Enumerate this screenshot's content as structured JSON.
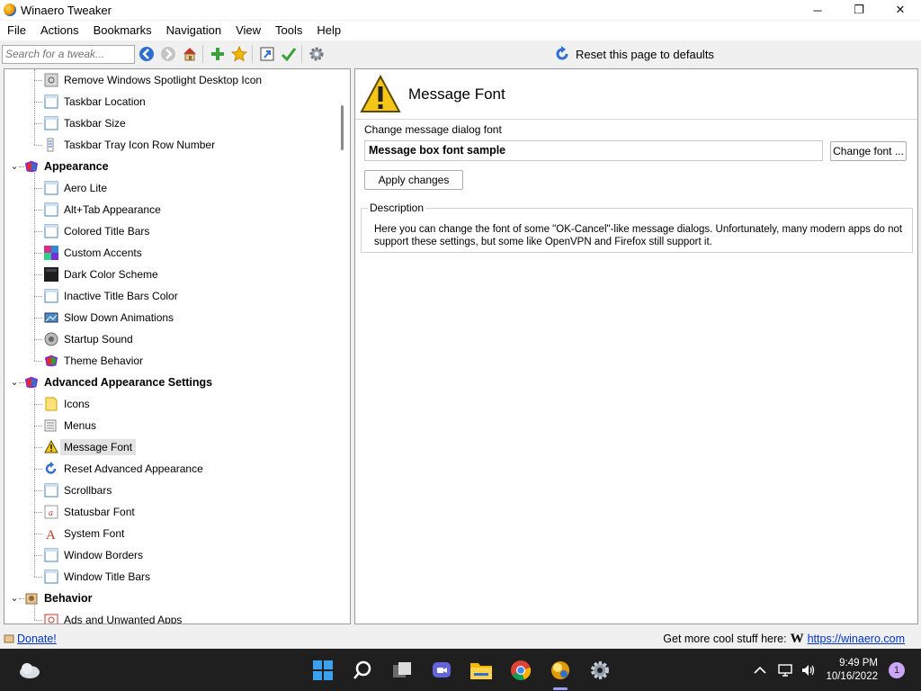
{
  "window": {
    "title": "Winaero Tweaker",
    "minimize": "─",
    "maximize": "❐",
    "close": "✕"
  },
  "menubar": [
    "File",
    "Actions",
    "Bookmarks",
    "Navigation",
    "View",
    "Tools",
    "Help"
  ],
  "toolbar": {
    "search_placeholder": "Search for a tweak...",
    "reset_page_label": "Reset this page to defaults"
  },
  "tree": {
    "items": [
      {
        "label": "Remove Windows Spotlight Desktop Icon",
        "icon": "spotlight-icon"
      },
      {
        "label": "Taskbar Location",
        "icon": "taskbar-location-icon"
      },
      {
        "label": "Taskbar Size",
        "icon": "taskbar-size-icon"
      },
      {
        "label": "Taskbar Tray Icon Row Number",
        "icon": "tray-rows-icon"
      },
      {
        "label": "Appearance",
        "icon": "appearance-icon"
      },
      {
        "label": "Aero Lite",
        "icon": "aero-lite-icon"
      },
      {
        "label": "Alt+Tab Appearance",
        "icon": "alt-tab-icon"
      },
      {
        "label": "Colored Title Bars",
        "icon": "colored-title-bars-icon"
      },
      {
        "label": "Custom Accents",
        "icon": "custom-accents-icon"
      },
      {
        "label": "Dark Color Scheme",
        "icon": "dark-scheme-icon"
      },
      {
        "label": "Inactive Title Bars Color",
        "icon": "inactive-title-bars-icon"
      },
      {
        "label": "Slow Down Animations",
        "icon": "animations-icon"
      },
      {
        "label": "Startup Sound",
        "icon": "startup-sound-icon"
      },
      {
        "label": "Theme Behavior",
        "icon": "theme-behavior-icon"
      },
      {
        "label": "Advanced Appearance Settings",
        "icon": "advanced-appearance-icon"
      },
      {
        "label": "Icons",
        "icon": "icons-icon"
      },
      {
        "label": "Menus",
        "icon": "menus-icon"
      },
      {
        "label": "Message Font",
        "icon": "warning-icon"
      },
      {
        "label": "Reset Advanced Appearance",
        "icon": "reset-icon"
      },
      {
        "label": "Scrollbars",
        "icon": "scrollbars-icon"
      },
      {
        "label": "Statusbar Font",
        "icon": "statusbar-font-icon"
      },
      {
        "label": "System Font",
        "icon": "system-font-icon"
      },
      {
        "label": "Window Borders",
        "icon": "window-borders-icon"
      },
      {
        "label": "Window Title Bars",
        "icon": "window-title-bars-icon"
      },
      {
        "label": "Behavior",
        "icon": "behavior-icon"
      },
      {
        "label": "Ads and Unwanted Apps",
        "icon": "ads-icon"
      }
    ]
  },
  "page": {
    "title": "Message Font",
    "change_label": "Change message dialog font",
    "font_sample": "Message box font sample",
    "change_font_button": "Change font ...",
    "apply_button": "Apply changes",
    "description_legend": "Description",
    "description_text": "Here you can change the font of some \"OK-Cancel\"-like message dialogs. Unfortunately, many modern apps do not support these settings, but some like OpenVPN and Firefox still support it."
  },
  "statusbar": {
    "donate": "Donate!",
    "promo": "Get more cool stuff here:",
    "logo": "W",
    "link": "https://winaero.com"
  },
  "taskbar": {
    "time": "9:49 PM",
    "date": "10/16/2022",
    "notification_count": "1"
  }
}
